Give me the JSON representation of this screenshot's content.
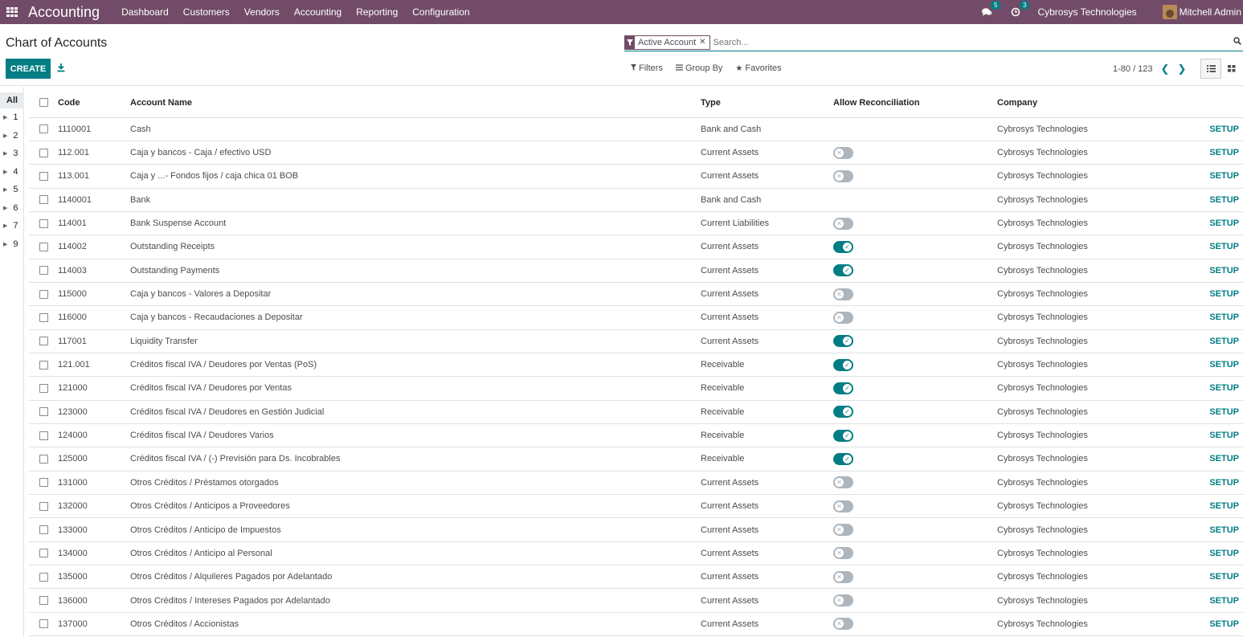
{
  "navbar": {
    "app_name": "Accounting",
    "menu": [
      "Dashboard",
      "Customers",
      "Vendors",
      "Accounting",
      "Reporting",
      "Configuration"
    ],
    "messages_count": "5",
    "activities_count": "3",
    "company": "Cybrosys Technologies",
    "user": "Mitchell Admin"
  },
  "control_panel": {
    "title": "Chart of Accounts",
    "facet": "Active Account",
    "search_placeholder": "Search...",
    "create_label": "CREATE",
    "filters_label": "Filters",
    "group_by_label": "Group By",
    "favorites_label": "Favorites",
    "pager": "1-80 / 123"
  },
  "tree": {
    "all_label": "All",
    "items": [
      "1",
      "2",
      "3",
      "4",
      "5",
      "6",
      "7",
      "9"
    ]
  },
  "table": {
    "headers": {
      "code": "Code",
      "name": "Account Name",
      "type": "Type",
      "reconcile": "Allow Reconciliation",
      "company": "Company"
    },
    "setup_label": "SETUP",
    "rows": [
      {
        "code": "1110001",
        "name": "Cash",
        "type": "Bank and Cash",
        "reconcile": null,
        "company": "Cybrosys Technologies"
      },
      {
        "code": "112.001",
        "name": "Caja y bancos - Caja / efectivo USD",
        "type": "Current Assets",
        "reconcile": false,
        "company": "Cybrosys Technologies"
      },
      {
        "code": "113.001",
        "name": "Caja y ...- Fondos fijos / caja chica 01 BOB",
        "type": "Current Assets",
        "reconcile": false,
        "company": "Cybrosys Technologies"
      },
      {
        "code": "1140001",
        "name": "Bank",
        "type": "Bank and Cash",
        "reconcile": null,
        "company": "Cybrosys Technologies"
      },
      {
        "code": "114001",
        "name": "Bank Suspense Account",
        "type": "Current Liabilities",
        "reconcile": false,
        "company": "Cybrosys Technologies"
      },
      {
        "code": "114002",
        "name": "Outstanding Receipts",
        "type": "Current Assets",
        "reconcile": true,
        "company": "Cybrosys Technologies"
      },
      {
        "code": "114003",
        "name": "Outstanding Payments",
        "type": "Current Assets",
        "reconcile": true,
        "company": "Cybrosys Technologies"
      },
      {
        "code": "115000",
        "name": "Caja y bancos - Valores a Depositar",
        "type": "Current Assets",
        "reconcile": false,
        "company": "Cybrosys Technologies"
      },
      {
        "code": "116000",
        "name": "Caja y bancos - Recaudaciones a Depositar",
        "type": "Current Assets",
        "reconcile": false,
        "company": "Cybrosys Technologies"
      },
      {
        "code": "117001",
        "name": "Liquidity Transfer",
        "type": "Current Assets",
        "reconcile": true,
        "company": "Cybrosys Technologies"
      },
      {
        "code": "121.001",
        "name": "Créditos fiscal IVA / Deudores por Ventas (PoS)",
        "type": "Receivable",
        "reconcile": true,
        "company": "Cybrosys Technologies"
      },
      {
        "code": "121000",
        "name": "Créditos fiscal IVA / Deudores por Ventas",
        "type": "Receivable",
        "reconcile": true,
        "company": "Cybrosys Technologies"
      },
      {
        "code": "123000",
        "name": "Créditos fiscal IVA / Deudores en Gestión Judicial",
        "type": "Receivable",
        "reconcile": true,
        "company": "Cybrosys Technologies"
      },
      {
        "code": "124000",
        "name": "Créditos fiscal IVA / Deudores Varios",
        "type": "Receivable",
        "reconcile": true,
        "company": "Cybrosys Technologies"
      },
      {
        "code": "125000",
        "name": "Créditos fiscal IVA / (-) Previsión para Ds. Incobrables",
        "type": "Receivable",
        "reconcile": true,
        "company": "Cybrosys Technologies"
      },
      {
        "code": "131000",
        "name": "Otros Créditos / Préstamos otorgados",
        "type": "Current Assets",
        "reconcile": false,
        "company": "Cybrosys Technologies"
      },
      {
        "code": "132000",
        "name": "Otros Créditos / Anticipos a Proveedores",
        "type": "Current Assets",
        "reconcile": false,
        "company": "Cybrosys Technologies"
      },
      {
        "code": "133000",
        "name": "Otros Créditos / Anticipo de Impuestos",
        "type": "Current Assets",
        "reconcile": false,
        "company": "Cybrosys Technologies"
      },
      {
        "code": "134000",
        "name": "Otros Créditos / Anticipo al Personal",
        "type": "Current Assets",
        "reconcile": false,
        "company": "Cybrosys Technologies"
      },
      {
        "code": "135000",
        "name": "Otros Créditos / Alquileres Pagados por Adelantado",
        "type": "Current Assets",
        "reconcile": false,
        "company": "Cybrosys Technologies"
      },
      {
        "code": "136000",
        "name": "Otros Créditos / Intereses Pagados por Adelantado",
        "type": "Current Assets",
        "reconcile": false,
        "company": "Cybrosys Technologies"
      },
      {
        "code": "137000",
        "name": "Otros Créditos / Accionistas",
        "type": "Current Assets",
        "reconcile": false,
        "company": "Cybrosys Technologies"
      }
    ]
  },
  "colors": {
    "brand": "#714B67",
    "accent": "#017e84",
    "toggle_off": "#adb5bd"
  }
}
